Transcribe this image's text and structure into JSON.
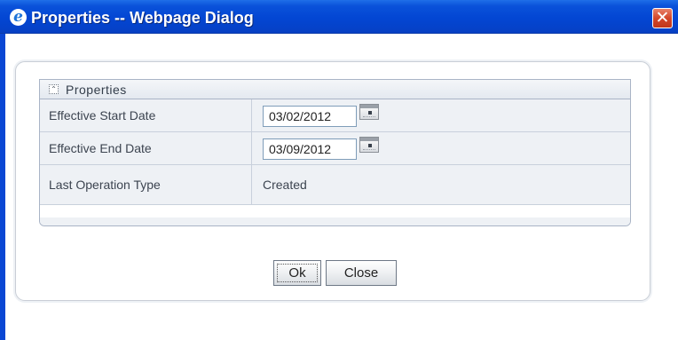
{
  "window": {
    "title": "Properties -- Webpage Dialog",
    "icon": "ie-browser-icon",
    "close_glyph": "✕"
  },
  "section": {
    "title": "Properties",
    "collapse_glyph": "⌃"
  },
  "rows": [
    {
      "label": "Effective Start Date",
      "value": "03/02/2012",
      "type": "date"
    },
    {
      "label": "Effective End Date",
      "value": "03/09/2012",
      "type": "date"
    },
    {
      "label": "Last Operation Type",
      "value": "Created",
      "type": "text"
    }
  ],
  "buttons": {
    "ok_label": "Ok",
    "close_label": "Close"
  },
  "colors": {
    "titlebar": "#0346d3",
    "close_button": "#d3472a",
    "row_background": "#eef1f5",
    "border": "#a9b4c6"
  }
}
